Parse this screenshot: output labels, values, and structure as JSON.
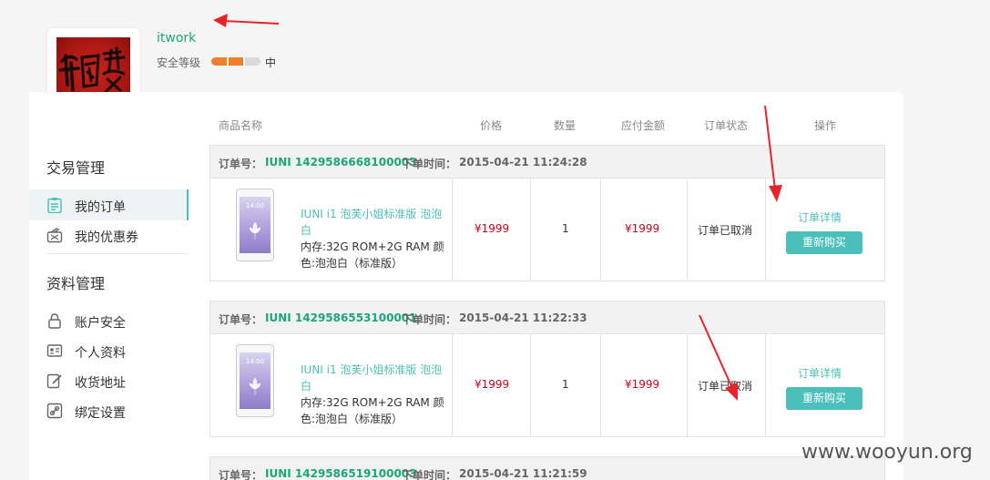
{
  "profile": {
    "username": "itwork",
    "security_label": "安全等级",
    "security_level": "中",
    "security_fraction": 0.66,
    "security_color": "#f07d2a"
  },
  "sidebar": {
    "sections": [
      {
        "title": "交易管理",
        "items": [
          {
            "label": "我的订单",
            "icon": "clipboard-icon",
            "active": true
          },
          {
            "label": "我的优惠券",
            "icon": "coupon-icon",
            "active": false
          }
        ]
      },
      {
        "title": "资料管理",
        "items": [
          {
            "label": "账户安全",
            "icon": "lock-icon",
            "active": false
          },
          {
            "label": "个人资料",
            "icon": "id-card-icon",
            "active": false
          },
          {
            "label": "收货地址",
            "icon": "edit-icon",
            "active": false
          },
          {
            "label": "绑定设置",
            "icon": "link-icon",
            "active": false
          }
        ]
      }
    ]
  },
  "table": {
    "headers": [
      "商品名称",
      "价格",
      "数量",
      "应付金额",
      "订单状态",
      "操作"
    ]
  },
  "orders": [
    {
      "order_no_label": "订单号：",
      "order_no": "IUNI 1429586668100003",
      "time_label": "下单时间：",
      "time": "2015-04-21 11:24:28",
      "product_name": "IUNI i1 泡芙小姐标准版 泡泡白",
      "product_spec": "内存:32G ROM+2G RAM 颜色:泡泡白（标准版）",
      "phone_time": "14:00",
      "price": "¥1999",
      "quantity": "1",
      "amount": "¥1999",
      "status": "订单已取消",
      "detail_label": "订单详情",
      "rebuy_label": "重新购买"
    },
    {
      "order_no_label": "订单号：",
      "order_no": "IUNI 1429586553100001",
      "time_label": "下单时间：",
      "time": "2015-04-21 11:22:33",
      "product_name": "IUNI i1 泡芙小姐标准版 泡泡白",
      "product_spec": "内存:32G ROM+2G RAM 颜色:泡泡白（标准版）",
      "phone_time": "14:00",
      "price": "¥1999",
      "quantity": "1",
      "amount": "¥1999",
      "status": "订单已取消",
      "detail_label": "订单详情",
      "rebuy_label": "重新购买"
    },
    {
      "order_no_label": "订单号：",
      "order_no": "IUNI 1429586519100003",
      "time_label": "下单时间：",
      "time": "2015-04-21 11:21:59"
    }
  ],
  "watermark": "www.wooyun.org",
  "colors": {
    "accent": "#4bbfb9",
    "green": "#1aa67a",
    "price": "#d0021b",
    "arrow": "#e8242b"
  }
}
